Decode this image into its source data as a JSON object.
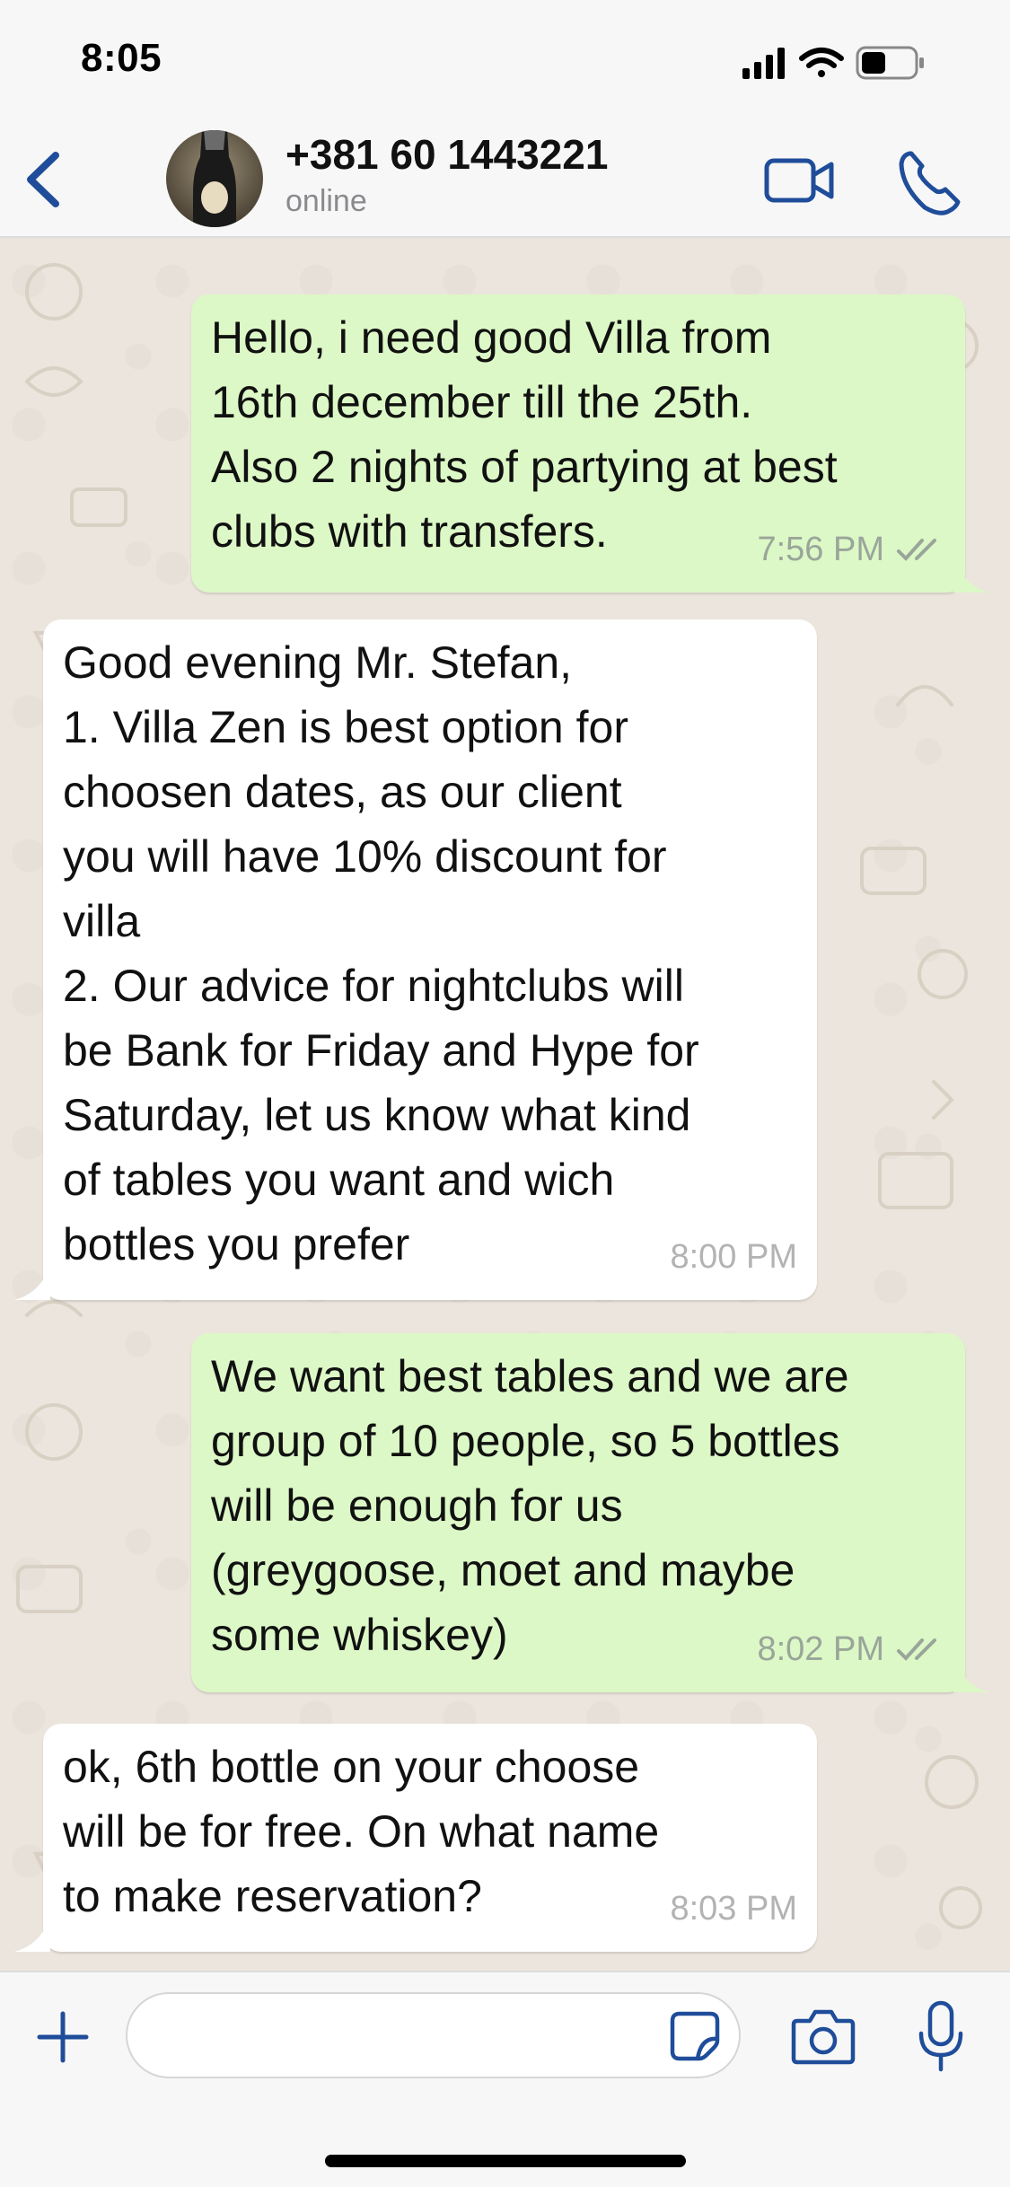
{
  "status_bar": {
    "time": "8:05"
  },
  "header": {
    "contact_name": "+381 60 1443221",
    "contact_status": "online"
  },
  "messages": [
    {
      "direction": "outgoing",
      "text": "Hello, i need good Villa from\n16th december till the 25th.\nAlso 2 nights of partying at best\nclubs with transfers.",
      "time": "7:56 PM",
      "read_receipt": "double-check-icon"
    },
    {
      "direction": "incoming",
      "text": "Good evening Mr. Stefan,\n1. Villa Zen is best option for\nchoosen dates, as our client\nyou will have 10% discount for\nvilla\n2. Our advice for nightclubs will\nbe Bank for Friday and Hype for\nSaturday, let us know what kind\nof tables you want and wich\nbottles you prefer",
      "time": "8:00 PM"
    },
    {
      "direction": "outgoing",
      "text": "We want best tables and we are\ngroup of 10 people, so 5 bottles\nwill be enough for us\n(greygoose, moet and maybe\nsome whiskey)",
      "time": "8:02 PM",
      "read_receipt": "double-check-icon"
    },
    {
      "direction": "incoming",
      "text": "ok, 6th bottle on your choose\nwill be for free. On what name\nto make reservation?",
      "time": "8:03 PM"
    }
  ],
  "composer": {
    "placeholder": ""
  },
  "colors": {
    "accent": "#1f4d9a",
    "outgoing_bubble": "#dcf8c6",
    "incoming_bubble": "#ffffff",
    "chat_background": "#ece5dd"
  }
}
